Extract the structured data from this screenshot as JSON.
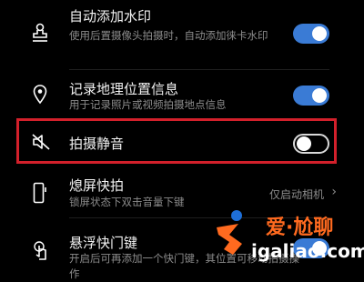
{
  "settings": [
    {
      "title": "自动添加水印",
      "subtitle": "使用后置摄像头拍摄时，自动添加徕卡水印",
      "toggle": true,
      "icon": "stamp-icon"
    },
    {
      "title": "记录地理位置信息",
      "subtitle": "用于记录照片或视频拍摄地点信息",
      "toggle": true,
      "icon": "location-pin-icon"
    },
    {
      "title": "拍摄静音",
      "toggle": false,
      "icon": "mute-speaker-icon"
    },
    {
      "title": "熄屏快拍",
      "subtitle": "锁屏状态下双击音量下键",
      "value": "仅启动相机",
      "icon": "phone-icon"
    },
    {
      "title": "悬浮快门键",
      "subtitle": "开启后可再添加一个快门键，其位置可移动拍摄操作",
      "toggle": true,
      "icon": "touch-icon"
    }
  ],
  "watermark": {
    "domain": "igaliao.com",
    "chinese": "爱·尬聊"
  },
  "colors": {
    "accent": "#3a7bd5",
    "highlight": "#d3202b"
  }
}
